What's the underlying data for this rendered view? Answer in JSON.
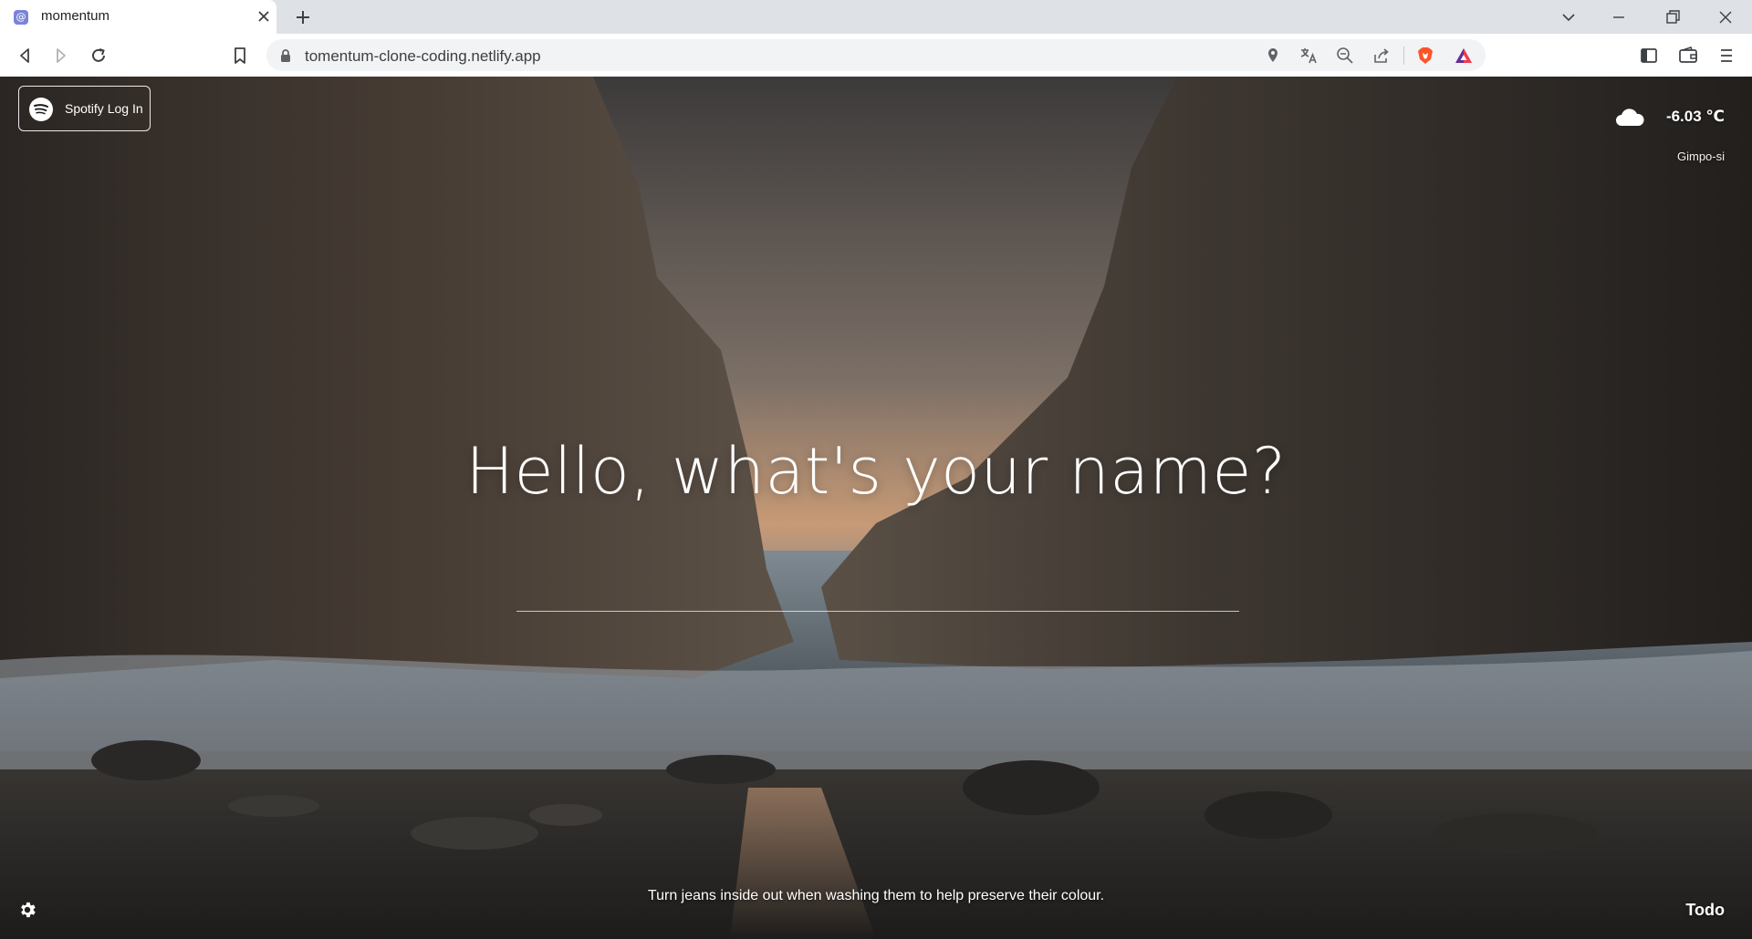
{
  "browser": {
    "tab": {
      "title": "momentum",
      "favicon_glyph": "@",
      "favicon_color": "#7b83d8"
    },
    "url": "tomentum-clone-coding.netlify.app",
    "accent_colors": {
      "brave_shield": "#fb542b",
      "rewards_triangle": "#662d91"
    }
  },
  "page": {
    "spotify_button": {
      "label": "Spotify Log In",
      "icon": "spotify-icon"
    },
    "weather": {
      "icon": "cloud-icon",
      "temperature": "-6.03 ℃",
      "city": "Gimpo-si"
    },
    "greeting": "Hello, what's your name?",
    "name_input": {
      "value": "",
      "placeholder": ""
    },
    "quote": "Turn jeans inside out when washing them to help preserve their colour.",
    "settings_icon": "gear-icon",
    "todo_label": "Todo"
  }
}
